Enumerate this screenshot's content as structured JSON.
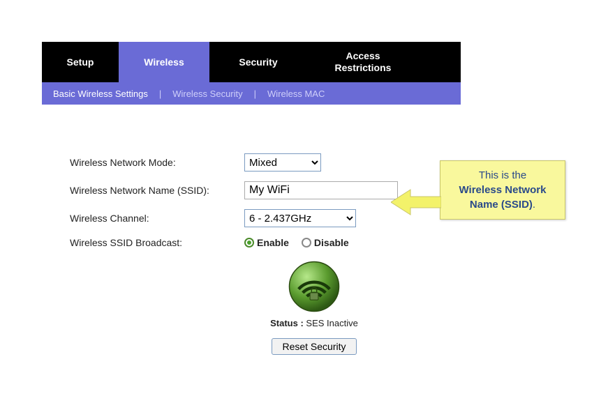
{
  "topnav": {
    "tabs": [
      "Setup",
      "Wireless",
      "Security",
      "Access\nRestrictions"
    ],
    "active_index": 1
  },
  "subnav": {
    "links": [
      "Basic Wireless Settings",
      "Wireless Security",
      "Wireless MAC"
    ],
    "active_index": 0
  },
  "form": {
    "mode_label": "Wireless Network Mode:",
    "mode_value": "Mixed",
    "ssid_label": "Wireless Network Name (SSID):",
    "ssid_value": "My WiFi",
    "channel_label": "Wireless Channel:",
    "channel_value": "6 - 2.437GHz",
    "broadcast_label": "Wireless SSID Broadcast:",
    "broadcast_enable": "Enable",
    "broadcast_disable": "Disable",
    "broadcast_selected": "Enable"
  },
  "ses": {
    "status_label": "Status :",
    "status_value": "SES Inactive",
    "reset_button": "Reset Security"
  },
  "callout": {
    "line1": "This is the",
    "line2_bold": "Wireless Network Name (SSID)",
    "line3": "."
  }
}
